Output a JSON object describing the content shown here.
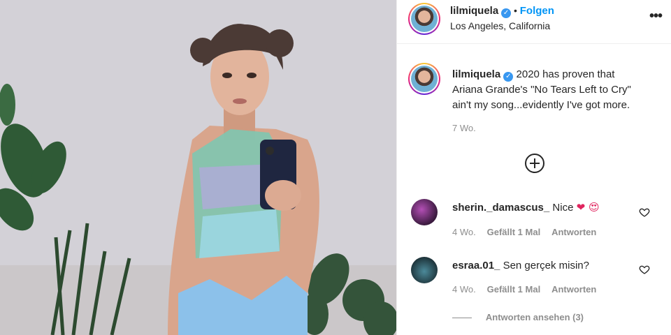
{
  "post": {
    "username": "lilmiquela",
    "follow_label": "Folgen",
    "separator": "•",
    "location": "Los Angeles, California",
    "more_label": "•••"
  },
  "caption": {
    "username": "lilmiquela",
    "line1": "2020 has proven that",
    "line2": "Ariana Grande's \"No Tears Left to Cry\"",
    "line3": "ain't my song...evidently I've got more.",
    "time": "7 Wo."
  },
  "comments": [
    {
      "username": "sherin._damascus_",
      "text": "Nice",
      "emojis": "❤ 😍",
      "time": "4 Wo.",
      "likes": "Gefällt 1 Mal",
      "reply": "Antworten"
    },
    {
      "username": "esraa.01_",
      "text": "Sen gerçek misin?",
      "time": "4 Wo.",
      "likes": "Gefällt 1 Mal",
      "reply": "Antworten"
    }
  ],
  "view_replies": "Antworten ansehen (3)",
  "colors": {
    "link": "#0095f6",
    "verified": "#3897f0",
    "muted": "#8e8e8e"
  }
}
